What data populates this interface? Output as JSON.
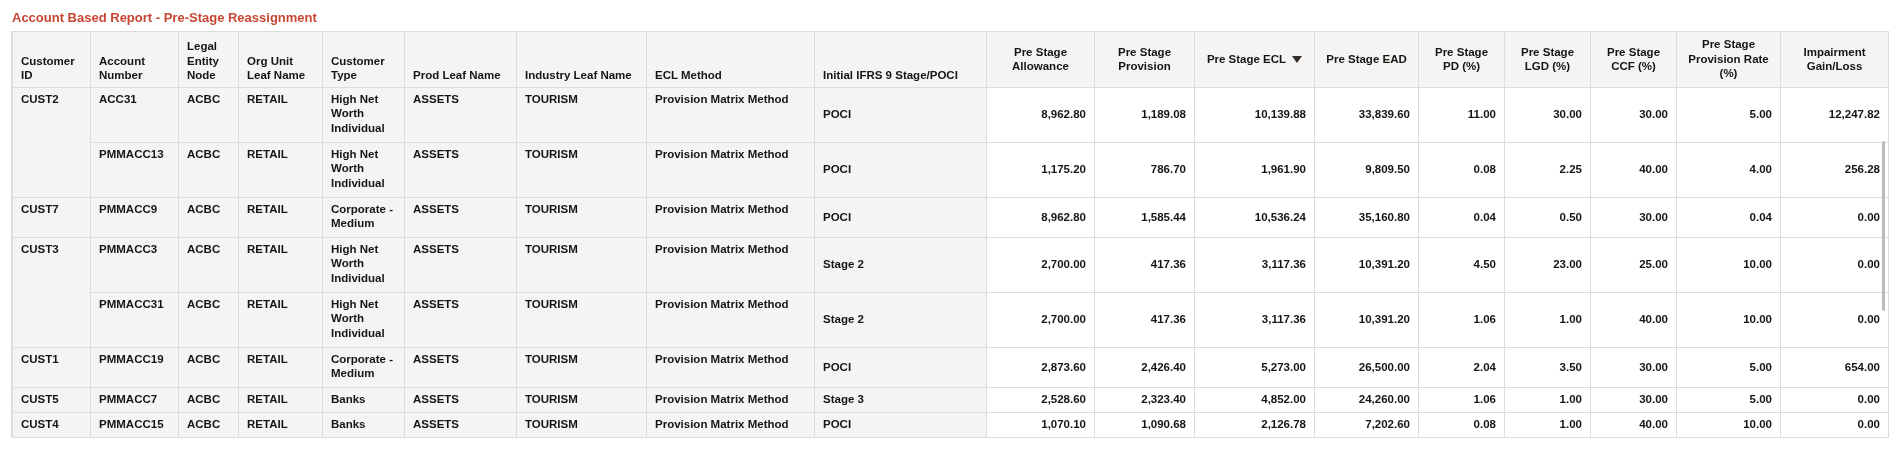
{
  "report": {
    "title": "Account Based Report - Pre-Stage Reassignment"
  },
  "table": {
    "columns": [
      {
        "label": "Customer ID",
        "kind": "text",
        "sorted": false
      },
      {
        "label": "Account Number",
        "kind": "text",
        "sorted": false
      },
      {
        "label": "Legal Entity Node",
        "kind": "text",
        "sorted": false
      },
      {
        "label": "Org Unit Leaf Name",
        "kind": "text",
        "sorted": false
      },
      {
        "label": "Customer Type",
        "kind": "text",
        "sorted": false
      },
      {
        "label": "Prod Leaf Name",
        "kind": "text",
        "sorted": false
      },
      {
        "label": "Industry Leaf Name",
        "kind": "text",
        "sorted": false
      },
      {
        "label": "ECL Method",
        "kind": "text",
        "sorted": false
      },
      {
        "label": "Initial IFRS 9 Stage/POCI",
        "kind": "stage",
        "sorted": false
      },
      {
        "label": "Pre Stage Allowance",
        "kind": "number",
        "sorted": false
      },
      {
        "label": "Pre Stage Provision",
        "kind": "number",
        "sorted": false
      },
      {
        "label": "Pre Stage ECL",
        "kind": "number",
        "sorted": true
      },
      {
        "label": "Pre Stage EAD",
        "kind": "number",
        "sorted": false
      },
      {
        "label": "Pre Stage PD (%)",
        "kind": "number",
        "sorted": false
      },
      {
        "label": "Pre Stage LGD (%)",
        "kind": "number",
        "sorted": false
      },
      {
        "label": "Pre Stage CCF (%)",
        "kind": "number",
        "sorted": false
      },
      {
        "label": "Pre Stage Provision Rate (%)",
        "kind": "number",
        "sorted": false
      },
      {
        "label": "Impairment Gain/Loss",
        "kind": "number",
        "sorted": false
      }
    ],
    "customers": [
      {
        "customer_id": "CUST2",
        "accounts": [
          {
            "cells": [
              "ACC31",
              "ACBC",
              "RETAIL",
              "High Net Worth Individual",
              "ASSETS",
              "TOURISM",
              "Provision Matrix Method",
              "POCI",
              "8,962.80",
              "1,189.08",
              "10,139.88",
              "33,839.60",
              "11.00",
              "30.00",
              "30.00",
              "5.00",
              "12,247.82"
            ]
          },
          {
            "cells": [
              "PMMACC13",
              "ACBC",
              "RETAIL",
              "High Net Worth Individual",
              "ASSETS",
              "TOURISM",
              "Provision Matrix Method",
              "POCI",
              "1,175.20",
              "786.70",
              "1,961.90",
              "9,809.50",
              "0.08",
              "2.25",
              "40.00",
              "4.00",
              "256.28"
            ]
          }
        ]
      },
      {
        "customer_id": "CUST7",
        "accounts": [
          {
            "cells": [
              "PMMACC9",
              "ACBC",
              "RETAIL",
              "Corporate - Medium",
              "ASSETS",
              "TOURISM",
              "Provision Matrix Method",
              "POCI",
              "8,962.80",
              "1,585.44",
              "10,536.24",
              "35,160.80",
              "0.04",
              "0.50",
              "30.00",
              "0.04",
              "0.00"
            ]
          }
        ]
      },
      {
        "customer_id": "CUST3",
        "accounts": [
          {
            "cells": [
              "PMMACC3",
              "ACBC",
              "RETAIL",
              "High Net Worth Individual",
              "ASSETS",
              "TOURISM",
              "Provision Matrix Method",
              "Stage 2",
              "2,700.00",
              "417.36",
              "3,117.36",
              "10,391.20",
              "4.50",
              "23.00",
              "25.00",
              "10.00",
              "0.00"
            ]
          },
          {
            "cells": [
              "PMMACC31",
              "ACBC",
              "RETAIL",
              "High Net Worth Individual",
              "ASSETS",
              "TOURISM",
              "Provision Matrix Method",
              "Stage 2",
              "2,700.00",
              "417.36",
              "3,117.36",
              "10,391.20",
              "1.06",
              "1.00",
              "40.00",
              "10.00",
              "0.00"
            ]
          }
        ]
      },
      {
        "customer_id": "CUST1",
        "accounts": [
          {
            "cells": [
              "PMMACC19",
              "ACBC",
              "RETAIL",
              "Corporate - Medium",
              "ASSETS",
              "TOURISM",
              "Provision Matrix Method",
              "POCI",
              "2,873.60",
              "2,426.40",
              "5,273.00",
              "26,500.00",
              "2.04",
              "3.50",
              "30.00",
              "5.00",
              "654.00"
            ]
          }
        ]
      },
      {
        "customer_id": "CUST5",
        "accounts": [
          {
            "cells": [
              "PMMACC7",
              "ACBC",
              "RETAIL",
              "Banks",
              "ASSETS",
              "TOURISM",
              "Provision Matrix Method",
              "Stage 3",
              "2,528.60",
              "2,323.40",
              "4,852.00",
              "24,260.00",
              "1.06",
              "1.00",
              "30.00",
              "5.00",
              "0.00"
            ]
          }
        ]
      },
      {
        "customer_id": "CUST4",
        "accounts": [
          {
            "cells": [
              "PMMACC15",
              "ACBC",
              "RETAIL",
              "Banks",
              "ASSETS",
              "TOURISM",
              "Provision Matrix Method",
              "POCI",
              "1,070.10",
              "1,090.68",
              "2,126.78",
              "7,202.60",
              "0.08",
              "1.00",
              "40.00",
              "10.00",
              "0.00"
            ]
          }
        ]
      }
    ]
  }
}
